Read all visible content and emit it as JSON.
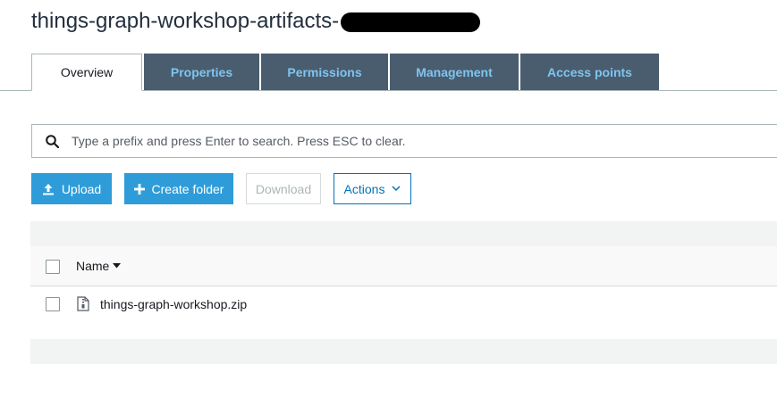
{
  "bucket": {
    "title": "things-graph-workshop-artifacts-"
  },
  "tabs": [
    {
      "label": "Overview",
      "active": true
    },
    {
      "label": "Properties",
      "active": false
    },
    {
      "label": "Permissions",
      "active": false
    },
    {
      "label": "Management",
      "active": false
    },
    {
      "label": "Access points",
      "active": false
    }
  ],
  "search": {
    "placeholder": "Type a prefix and press Enter to search. Press ESC to clear.",
    "value": ""
  },
  "toolbar": {
    "upload_label": "Upload",
    "create_folder_label": "Create folder",
    "download_label": "Download",
    "actions_label": "Actions"
  },
  "table": {
    "columns": [
      {
        "label": "Name",
        "sort": "descending"
      }
    ],
    "rows": [
      {
        "name": "things-graph-workshop.zip",
        "type": "zip-file"
      }
    ]
  },
  "colors": {
    "tab_inactive_bg": "#4a5d6e",
    "tab_inactive_text": "#7fc4f0",
    "primary_button": "#2e9cd9",
    "outline_button": "#0073bb"
  },
  "icons": {
    "search": "search-icon",
    "upload": "upload-icon",
    "create_folder": "plus-icon",
    "actions_dropdown": "chevron-down-icon",
    "sort": "caret-down-icon",
    "file": "zip-file-icon"
  }
}
